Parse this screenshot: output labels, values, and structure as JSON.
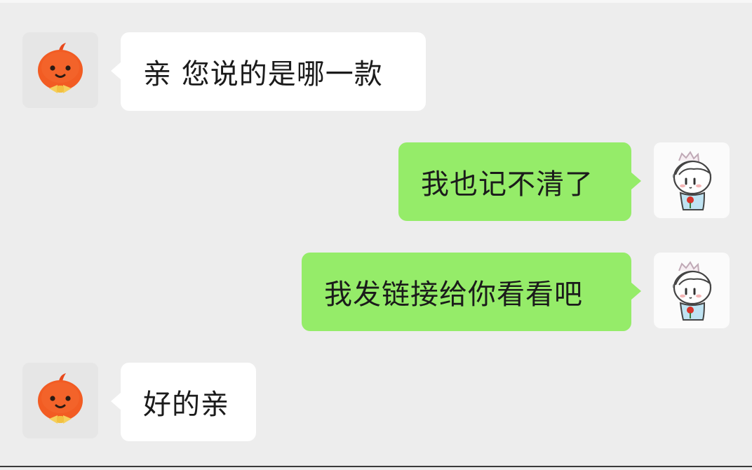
{
  "theme": {
    "background": "#ededed",
    "incoming_bubble": "#ffffff",
    "outgoing_bubble": "#95ec69",
    "text": "#1b1b1b"
  },
  "avatars": {
    "seller": "orange-mascot-icon",
    "user": "cartoon-boy-icon"
  },
  "messages": [
    {
      "sender": "seller",
      "direction": "in",
      "text": "亲 您说的是哪一款"
    },
    {
      "sender": "user",
      "direction": "out",
      "text": "我也记不清了"
    },
    {
      "sender": "user",
      "direction": "out",
      "text": "我发链接给你看看吧"
    },
    {
      "sender": "seller",
      "direction": "in",
      "text": "好的亲"
    }
  ]
}
